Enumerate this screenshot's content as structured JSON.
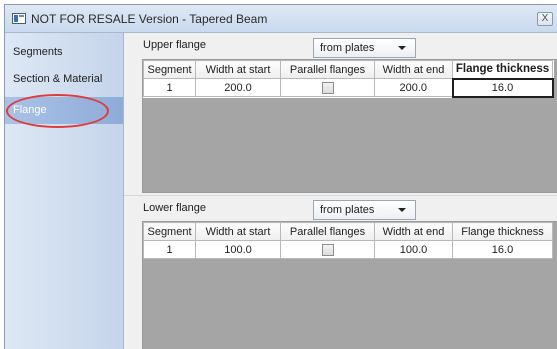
{
  "window": {
    "title": "NOT FOR RESALE Version - Tapered Beam",
    "close_label": "X"
  },
  "sidebar": {
    "items": [
      {
        "label": "Segments",
        "selected": false
      },
      {
        "label": "Section & Material",
        "selected": false
      },
      {
        "label": "Flange",
        "selected": true
      }
    ]
  },
  "upper_flange": {
    "label": "Upper flange",
    "source_selected": "from plates",
    "columns": [
      "Segment",
      "Width at start",
      "Parallel flanges",
      "Width at end",
      "Flange thickness"
    ],
    "rows": [
      {
        "segment": "1",
        "width_start": "200.0",
        "parallel_checked": false,
        "width_end": "200.0",
        "thickness": "16.0"
      }
    ]
  },
  "lower_flange": {
    "label": "Lower flange",
    "source_selected": "from plates",
    "columns": [
      "Segment",
      "Width at start",
      "Parallel flanges",
      "Width at end",
      "Flange thickness"
    ],
    "rows": [
      {
        "segment": "1",
        "width_start": "100.0",
        "parallel_checked": false,
        "width_end": "100.0",
        "thickness": "16.0"
      }
    ]
  },
  "colors": {
    "highlight": "#e03b3b",
    "selected_nav": "#8eacd8",
    "grid_background": "#a5a5a5"
  }
}
